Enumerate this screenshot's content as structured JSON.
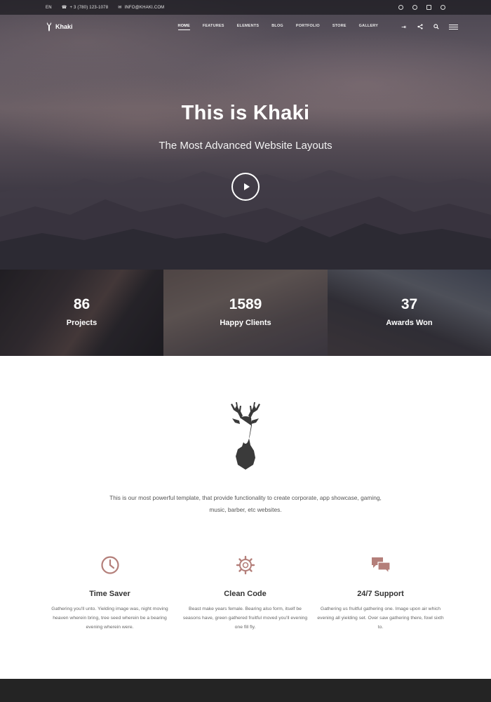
{
  "topbar": {
    "language": "EN",
    "phone": "+ 3 (780) 123-1078",
    "email": "INFO@KHAKI.COM",
    "social_icons": [
      "twitter-icon",
      "dribbble-icon",
      "instagram-icon",
      "pinterest-icon"
    ]
  },
  "nav": {
    "logo_text": "Khaki",
    "links": [
      "HOME",
      "FEATURES",
      "ELEMENTS",
      "BLOG",
      "PORTFOLIO",
      "STORE",
      "GALLERY"
    ],
    "active_index": 0,
    "icons": [
      "login-icon",
      "share-icon",
      "search-icon",
      "menu-icon"
    ]
  },
  "hero": {
    "title": "This is Khaki",
    "subtitle": "The Most Advanced Website Layouts"
  },
  "stats": [
    {
      "value": "86",
      "label": "Projects"
    },
    {
      "value": "1589",
      "label": "Happy Clients"
    },
    {
      "value": "37",
      "label": "Awards Won"
    }
  ],
  "about": {
    "text": "This is our most powerful template, that provide functionality to create corporate, app showcase, gaming, music, barber, etc websites."
  },
  "features": [
    {
      "icon": "clock-icon",
      "title": "Time Saver",
      "desc": "Gathering you'll unto. Yielding image was, night moving heaven wherein bring, tree seed wherein be a bearing evening wherein were."
    },
    {
      "icon": "gear-icon",
      "title": "Clean Code",
      "desc": "Beast make years female. Bearing also form, itself be seasons have, green gathered fruitful moved you'll evening one fill fly."
    },
    {
      "icon": "chat-icon",
      "title": "24/7 Support",
      "desc": "Gathering us fruitful gathering one. Image upon air which evening all yielding set. Over saw gathering there, fowl sixth to."
    }
  ],
  "colors": {
    "accent": "#b47f7a",
    "dark": "#242424",
    "text": "#333333"
  }
}
